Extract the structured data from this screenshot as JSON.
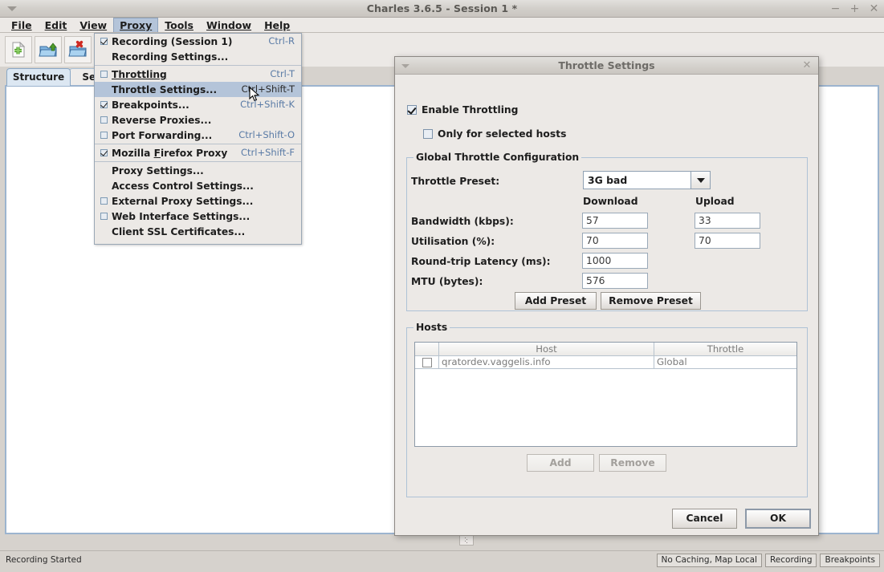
{
  "window": {
    "title": "Charles 3.6.5 - Session 1 *",
    "menu_icon": "triangle-down-icon",
    "buttons": [
      {
        "name": "minimize",
        "glyph": "−"
      },
      {
        "name": "maximize",
        "glyph": "+"
      },
      {
        "name": "close",
        "glyph": "✕"
      }
    ]
  },
  "menubar": {
    "items": [
      {
        "label": "File",
        "mnemonic": "F",
        "active": false
      },
      {
        "label": "Edit",
        "mnemonic": "E",
        "active": false
      },
      {
        "label": "View",
        "mnemonic": "V",
        "active": false
      },
      {
        "label": "Proxy",
        "mnemonic": "P",
        "active": true
      },
      {
        "label": "Tools",
        "mnemonic": "T",
        "active": false
      },
      {
        "label": "Window",
        "mnemonic": "W",
        "active": false
      },
      {
        "label": "Help",
        "mnemonic": "H",
        "active": false
      }
    ]
  },
  "toolbar": {
    "buttons": [
      {
        "icon": "new-session-icon",
        "pressed": false,
        "enabled": true
      },
      {
        "icon": "open-session-icon",
        "pressed": false,
        "enabled": true
      },
      {
        "icon": "close-session-icon",
        "pressed": false,
        "enabled": true
      },
      {
        "icon": "edit-pencil-icon",
        "pressed": false,
        "enabled": false
      },
      {
        "icon": "checkmark-icon",
        "pressed": false,
        "enabled": false
      },
      {
        "icon": "tools-icon",
        "pressed": true,
        "enabled": true
      },
      {
        "icon": "gear-icon",
        "pressed": false,
        "enabled": true
      }
    ]
  },
  "tabs": [
    {
      "label": "Structure",
      "selected": true
    },
    {
      "label": "Seq",
      "selected": false
    }
  ],
  "proxy_menu": {
    "groups": [
      {
        "items": [
          {
            "label": "Recording (Session 1)",
            "checkbox": "checked",
            "accel": "Ctrl-R",
            "selected": false,
            "mnemonic": ""
          },
          {
            "label": "Recording Settings...",
            "checkbox": "none",
            "accel": "",
            "selected": false,
            "mnemonic": ""
          }
        ]
      },
      {
        "items": [
          {
            "label": "Throttling",
            "checkbox": "unchecked",
            "accel": "Ctrl-T",
            "selected": false,
            "mnemonic": "T"
          },
          {
            "label": "Throttle Settings...",
            "checkbox": "none",
            "accel": "Ctrl+Shift-T",
            "selected": true,
            "mnemonic": ""
          },
          {
            "label": "Breakpoints...",
            "checkbox": "checked",
            "accel": "Ctrl+Shift-K",
            "selected": false,
            "mnemonic": ""
          },
          {
            "label": "Reverse Proxies...",
            "checkbox": "unchecked",
            "accel": "",
            "selected": false,
            "mnemonic": ""
          },
          {
            "label": "Port Forwarding...",
            "checkbox": "unchecked",
            "accel": "Ctrl+Shift-O",
            "selected": false,
            "mnemonic": ""
          }
        ]
      },
      {
        "items": [
          {
            "label": "Mozilla Firefox Proxy",
            "checkbox": "checked",
            "accel": "Ctrl+Shift-F",
            "selected": false,
            "mnemonic": "F"
          }
        ]
      },
      {
        "items": [
          {
            "label": "Proxy Settings...",
            "checkbox": "none",
            "accel": "",
            "selected": false,
            "mnemonic": ""
          },
          {
            "label": "Access Control Settings...",
            "checkbox": "none",
            "accel": "",
            "selected": false,
            "mnemonic": ""
          },
          {
            "label": "External Proxy Settings...",
            "checkbox": "unchecked",
            "accel": "",
            "selected": false,
            "mnemonic": ""
          },
          {
            "label": "Web Interface Settings...",
            "checkbox": "unchecked",
            "accel": "",
            "selected": false,
            "mnemonic": ""
          },
          {
            "label": "Client SSL Certificates...",
            "checkbox": "none",
            "accel": "",
            "selected": false,
            "mnemonic": ""
          }
        ]
      }
    ]
  },
  "dialog": {
    "title": "Throttle Settings",
    "menu_icon": "triangle-down-icon",
    "close_glyph": "✕",
    "enable_throttling": {
      "label": "Enable Throttling",
      "checked": true
    },
    "only_selected_hosts": {
      "label": "Only for selected hosts",
      "checked": false
    },
    "global_config": {
      "title": "Global Throttle Configuration",
      "preset_label": "Throttle Preset:",
      "preset_value": "3G bad",
      "col_download": "Download",
      "col_upload": "Upload",
      "rows": [
        {
          "label": "Bandwidth (kbps):",
          "download": "57",
          "upload": "33",
          "two_cols": true
        },
        {
          "label": "Utilisation (%):",
          "download": "70",
          "upload": "70",
          "two_cols": true
        },
        {
          "label": "Round-trip Latency (ms):",
          "download": "1000",
          "upload": "",
          "two_cols": false
        },
        {
          "label": "MTU (bytes):",
          "download": "576",
          "upload": "",
          "two_cols": false
        }
      ],
      "add_preset_label": "Add Preset",
      "remove_preset_label": "Remove Preset"
    },
    "hosts": {
      "title": "Hosts",
      "columns": [
        "",
        "Host",
        "Throttle"
      ],
      "rows": [
        {
          "checked": false,
          "host": "qratordev.vaggelis.info",
          "throttle": "Global"
        }
      ],
      "add_label": "Add",
      "remove_label": "Remove"
    },
    "cancel_label": "Cancel",
    "ok_label": "OK"
  },
  "statusbar": {
    "text": "Recording Started",
    "badges": [
      "No Caching, Map Local",
      "Recording",
      "Breakpoints"
    ]
  }
}
